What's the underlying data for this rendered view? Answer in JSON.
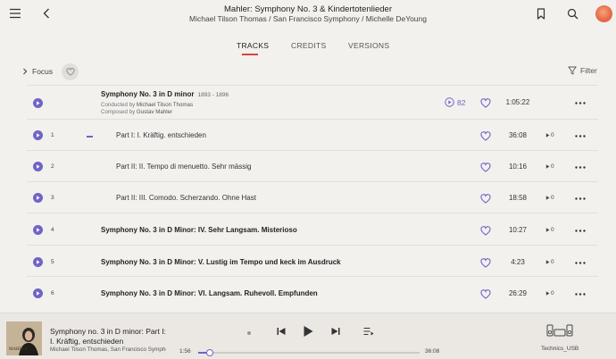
{
  "header": {
    "title": "Mahler: Symphony No. 3 & Kindertotenlieder",
    "subtitle": "Michael Tilson Thomas / San Francisco Symphony / Michelle DeYoung"
  },
  "tabs": [
    {
      "label": "TRACKS",
      "active": true
    },
    {
      "label": "CREDITS",
      "active": false
    },
    {
      "label": "VERSIONS",
      "active": false
    }
  ],
  "toolbar": {
    "focus_label": "Focus",
    "filter_label": "Filter"
  },
  "work": {
    "title": "Symphony No. 3 in D minor",
    "years": "1893 - 1896",
    "conducted_prefix": "Conducted by",
    "conductor": "Michael Tilson Thomas",
    "composed_prefix": "Composed by",
    "composer": "Gustav Mahler",
    "disc_count": "82",
    "duration": "1:05:22"
  },
  "tracks": [
    {
      "number": "1",
      "title": "Part I: I. Kräftig. entschieden",
      "duration": "36:08",
      "plays": "0",
      "indented": true
    },
    {
      "number": "2",
      "title": "Part II: II. Tempo di menuetto. Sehr mässig",
      "duration": "10:16",
      "plays": "0",
      "indented": true
    },
    {
      "number": "3",
      "title": "Part II: III. Comodo. Scherzando. Ohne Hast",
      "duration": "18:58",
      "plays": "0",
      "indented": true
    },
    {
      "number": "4",
      "title": "Symphony No. 3 in D Minor: IV. Sehr Langsam. Misterioso",
      "duration": "10:27",
      "plays": "0",
      "indented": false
    },
    {
      "number": "5",
      "title": "Symphony No. 3 in D Minor: V. Lustig im Tempo und keck im Ausdruck",
      "duration": "4:23",
      "plays": "0",
      "indented": false
    },
    {
      "number": "6",
      "title": "Symphony No. 3 in D Minor: VI. Langsam. Ruhevoll. Empfunden",
      "duration": "26:29",
      "plays": "0",
      "indented": false
    }
  ],
  "player": {
    "cover_text": "MAHLER",
    "title_line1": "Symphony no. 3 in D minor: Part I:",
    "title_line2": "I. Kräftig, entschieden",
    "artist": "Michael Tilson Thomas, San Francisco Symphony",
    "elapsed": "1:56",
    "total": "36:08",
    "progress": 0.054,
    "device": "Technics_USB"
  },
  "colors": {
    "accent": "#6f64c7",
    "tab_indicator": "#d9433d",
    "background": "#f3f1ee",
    "avatar": "#e86c4b"
  },
  "icons": [
    "menu-icon",
    "back-icon",
    "bookmark-icon",
    "search-icon",
    "heart-icon",
    "filter-icon",
    "play-icon",
    "more-icon",
    "disc-icon",
    "prev-icon",
    "next-icon",
    "queue-icon",
    "speaker-icon"
  ]
}
